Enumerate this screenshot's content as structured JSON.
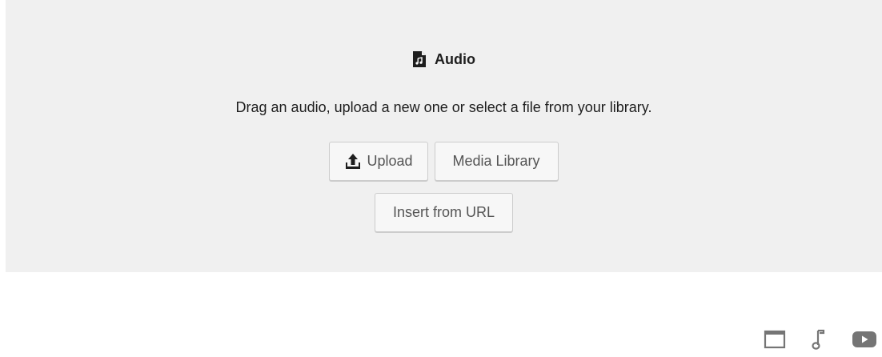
{
  "placeholder": {
    "icon": "audio-file-icon",
    "title": "Audio",
    "instructions": "Drag an audio, upload a new one or select a file from your library.",
    "buttons": {
      "upload": {
        "label": "Upload",
        "icon": "upload-icon"
      },
      "media_library": {
        "label": "Media Library"
      },
      "insert_url": {
        "label": "Insert from URL"
      }
    }
  },
  "toolbar": {
    "items": [
      {
        "icon": "window-icon"
      },
      {
        "icon": "music-note-icon"
      },
      {
        "icon": "video-play-icon"
      }
    ]
  },
  "colors": {
    "placeholder_bg": "#f0f0f0",
    "text": "#1e1e1e",
    "button_text": "#555555",
    "button_border": "#cccccc",
    "toolbar_icon": "#757575"
  }
}
